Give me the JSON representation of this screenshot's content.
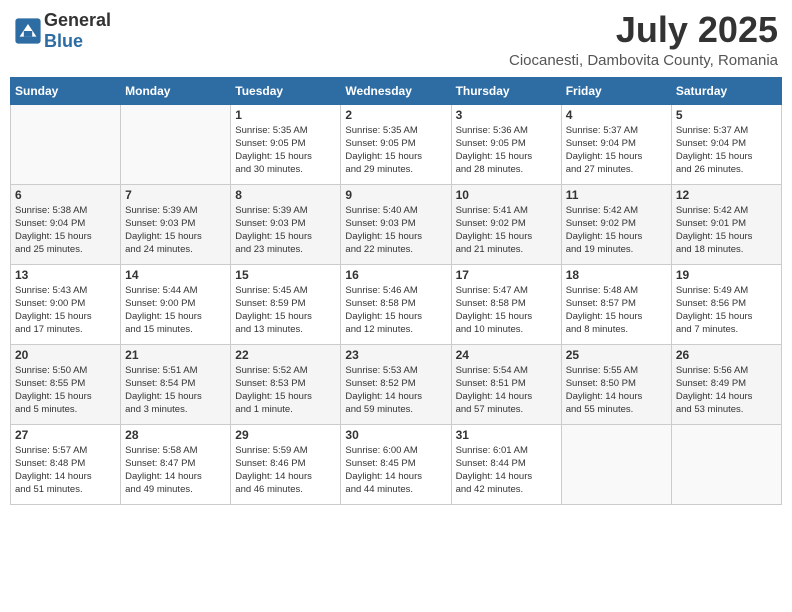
{
  "header": {
    "logo_general": "General",
    "logo_blue": "Blue",
    "month_year": "July 2025",
    "location": "Ciocanesti, Dambovita County, Romania"
  },
  "weekdays": [
    "Sunday",
    "Monday",
    "Tuesday",
    "Wednesday",
    "Thursday",
    "Friday",
    "Saturday"
  ],
  "weeks": [
    [
      {
        "day": "",
        "info": ""
      },
      {
        "day": "",
        "info": ""
      },
      {
        "day": "1",
        "info": "Sunrise: 5:35 AM\nSunset: 9:05 PM\nDaylight: 15 hours\nand 30 minutes."
      },
      {
        "day": "2",
        "info": "Sunrise: 5:35 AM\nSunset: 9:05 PM\nDaylight: 15 hours\nand 29 minutes."
      },
      {
        "day": "3",
        "info": "Sunrise: 5:36 AM\nSunset: 9:05 PM\nDaylight: 15 hours\nand 28 minutes."
      },
      {
        "day": "4",
        "info": "Sunrise: 5:37 AM\nSunset: 9:04 PM\nDaylight: 15 hours\nand 27 minutes."
      },
      {
        "day": "5",
        "info": "Sunrise: 5:37 AM\nSunset: 9:04 PM\nDaylight: 15 hours\nand 26 minutes."
      }
    ],
    [
      {
        "day": "6",
        "info": "Sunrise: 5:38 AM\nSunset: 9:04 PM\nDaylight: 15 hours\nand 25 minutes."
      },
      {
        "day": "7",
        "info": "Sunrise: 5:39 AM\nSunset: 9:03 PM\nDaylight: 15 hours\nand 24 minutes."
      },
      {
        "day": "8",
        "info": "Sunrise: 5:39 AM\nSunset: 9:03 PM\nDaylight: 15 hours\nand 23 minutes."
      },
      {
        "day": "9",
        "info": "Sunrise: 5:40 AM\nSunset: 9:03 PM\nDaylight: 15 hours\nand 22 minutes."
      },
      {
        "day": "10",
        "info": "Sunrise: 5:41 AM\nSunset: 9:02 PM\nDaylight: 15 hours\nand 21 minutes."
      },
      {
        "day": "11",
        "info": "Sunrise: 5:42 AM\nSunset: 9:02 PM\nDaylight: 15 hours\nand 19 minutes."
      },
      {
        "day": "12",
        "info": "Sunrise: 5:42 AM\nSunset: 9:01 PM\nDaylight: 15 hours\nand 18 minutes."
      }
    ],
    [
      {
        "day": "13",
        "info": "Sunrise: 5:43 AM\nSunset: 9:00 PM\nDaylight: 15 hours\nand 17 minutes."
      },
      {
        "day": "14",
        "info": "Sunrise: 5:44 AM\nSunset: 9:00 PM\nDaylight: 15 hours\nand 15 minutes."
      },
      {
        "day": "15",
        "info": "Sunrise: 5:45 AM\nSunset: 8:59 PM\nDaylight: 15 hours\nand 13 minutes."
      },
      {
        "day": "16",
        "info": "Sunrise: 5:46 AM\nSunset: 8:58 PM\nDaylight: 15 hours\nand 12 minutes."
      },
      {
        "day": "17",
        "info": "Sunrise: 5:47 AM\nSunset: 8:58 PM\nDaylight: 15 hours\nand 10 minutes."
      },
      {
        "day": "18",
        "info": "Sunrise: 5:48 AM\nSunset: 8:57 PM\nDaylight: 15 hours\nand 8 minutes."
      },
      {
        "day": "19",
        "info": "Sunrise: 5:49 AM\nSunset: 8:56 PM\nDaylight: 15 hours\nand 7 minutes."
      }
    ],
    [
      {
        "day": "20",
        "info": "Sunrise: 5:50 AM\nSunset: 8:55 PM\nDaylight: 15 hours\nand 5 minutes."
      },
      {
        "day": "21",
        "info": "Sunrise: 5:51 AM\nSunset: 8:54 PM\nDaylight: 15 hours\nand 3 minutes."
      },
      {
        "day": "22",
        "info": "Sunrise: 5:52 AM\nSunset: 8:53 PM\nDaylight: 15 hours\nand 1 minute."
      },
      {
        "day": "23",
        "info": "Sunrise: 5:53 AM\nSunset: 8:52 PM\nDaylight: 14 hours\nand 59 minutes."
      },
      {
        "day": "24",
        "info": "Sunrise: 5:54 AM\nSunset: 8:51 PM\nDaylight: 14 hours\nand 57 minutes."
      },
      {
        "day": "25",
        "info": "Sunrise: 5:55 AM\nSunset: 8:50 PM\nDaylight: 14 hours\nand 55 minutes."
      },
      {
        "day": "26",
        "info": "Sunrise: 5:56 AM\nSunset: 8:49 PM\nDaylight: 14 hours\nand 53 minutes."
      }
    ],
    [
      {
        "day": "27",
        "info": "Sunrise: 5:57 AM\nSunset: 8:48 PM\nDaylight: 14 hours\nand 51 minutes."
      },
      {
        "day": "28",
        "info": "Sunrise: 5:58 AM\nSunset: 8:47 PM\nDaylight: 14 hours\nand 49 minutes."
      },
      {
        "day": "29",
        "info": "Sunrise: 5:59 AM\nSunset: 8:46 PM\nDaylight: 14 hours\nand 46 minutes."
      },
      {
        "day": "30",
        "info": "Sunrise: 6:00 AM\nSunset: 8:45 PM\nDaylight: 14 hours\nand 44 minutes."
      },
      {
        "day": "31",
        "info": "Sunrise: 6:01 AM\nSunset: 8:44 PM\nDaylight: 14 hours\nand 42 minutes."
      },
      {
        "day": "",
        "info": ""
      },
      {
        "day": "",
        "info": ""
      }
    ]
  ]
}
